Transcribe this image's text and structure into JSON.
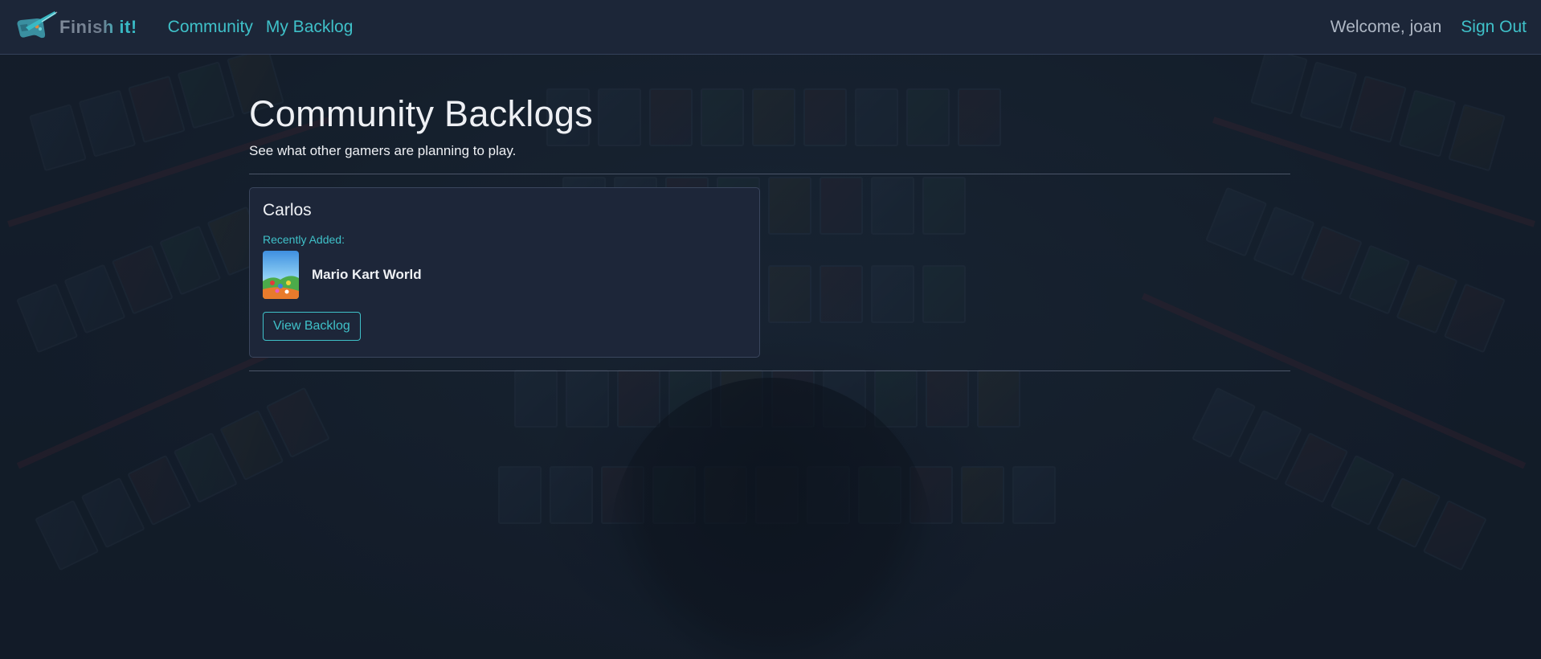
{
  "brand": {
    "name": "Finish it!",
    "logo": "gamepad-logo-icon"
  },
  "nav": {
    "links": [
      "Community",
      "My Backlog"
    ],
    "welcome": "Welcome, joan",
    "signout": "Sign Out"
  },
  "page": {
    "title": "Community Backlogs",
    "subtitle": "See what other gamers are planning to play."
  },
  "cards": [
    {
      "user": "Carlos",
      "recent_label": "Recently Added:",
      "game_title": "Mario Kart World",
      "button": "View Backlog"
    }
  ],
  "colors": {
    "accent": "#3fc1c9",
    "navbar_bg": "#1c2638",
    "card_bg": "#1d2639",
    "text": "#eef0f4"
  }
}
